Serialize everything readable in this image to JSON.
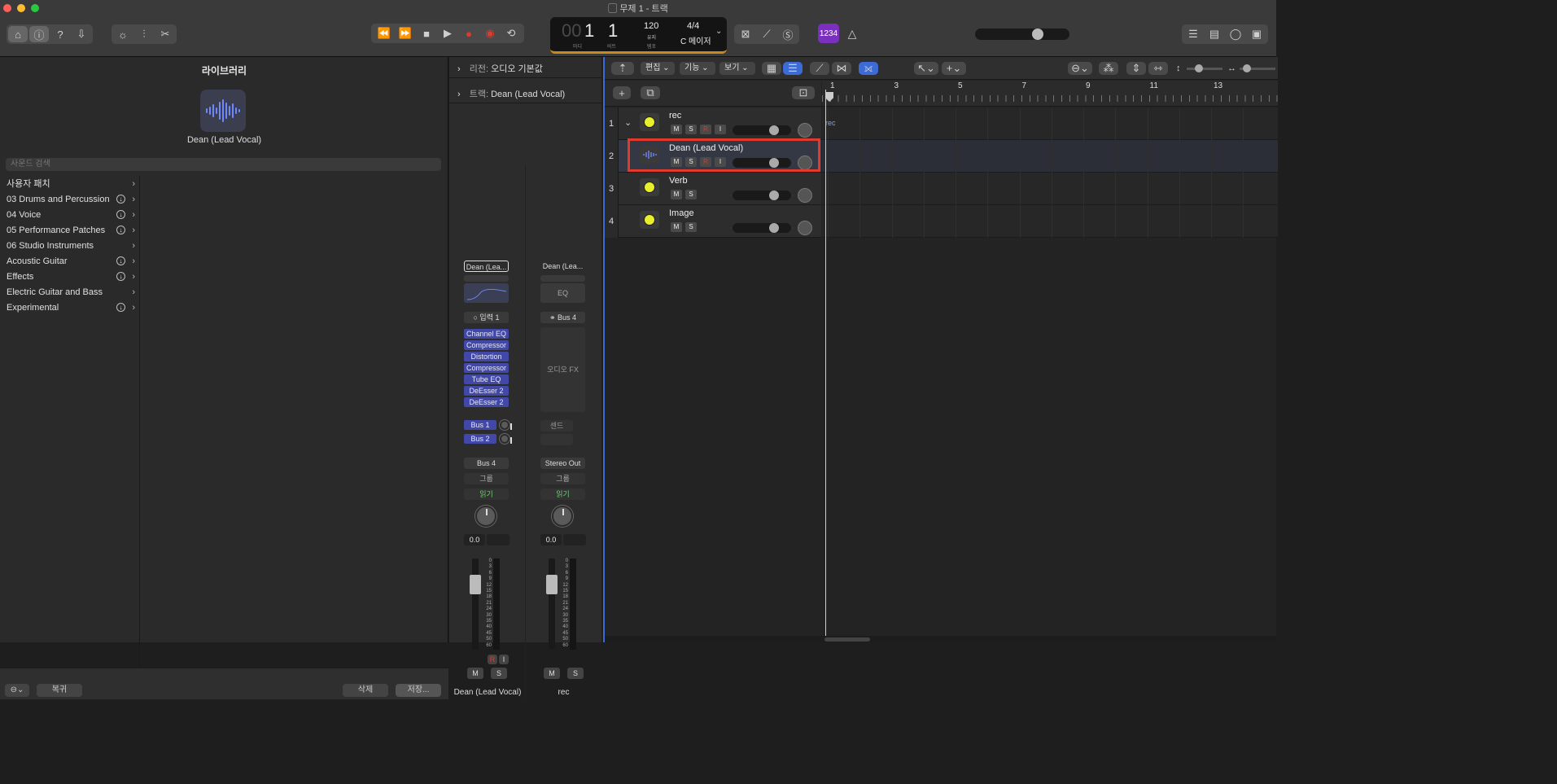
{
  "window": {
    "title": "무제 1 - 트랙"
  },
  "colors": {
    "accent": "#3d6bd6",
    "plugin": "#4148a8",
    "highlight": "#e03a2c",
    "lcd_bar": "#c98a1d"
  },
  "lcd": {
    "bar_prefix": "00",
    "bar": "1",
    "beat": "1",
    "bar_label": "마디",
    "beat_label": "비트",
    "tempo": "120",
    "tempo_mode": "유지",
    "tempo_label": "템포",
    "signature": "4/4",
    "key": "C 메이저"
  },
  "count_in": "1234",
  "library": {
    "title": "라이브러리",
    "selected_name": "Dean (Lead Vocal)",
    "search_placeholder": "사운드 검색",
    "items": [
      {
        "label": "사용자 패치",
        "download": false
      },
      {
        "label": "03 Drums and Percussion",
        "download": true
      },
      {
        "label": "04 Voice",
        "download": true
      },
      {
        "label": "05 Performance Patches",
        "download": true
      },
      {
        "label": "06 Studio Instruments",
        "download": false
      },
      {
        "label": "Acoustic Guitar",
        "download": true
      },
      {
        "label": "Effects",
        "download": true
      },
      {
        "label": "Electric Guitar and Bass",
        "download": false
      },
      {
        "label": "Experimental",
        "download": true
      }
    ],
    "revert": "복귀",
    "delete": "삭제",
    "save": "저장..."
  },
  "inspector": {
    "region_label": "리전:",
    "region_value": "오디오 기본값",
    "track_label": "트랙:",
    "track_value": "Dean (Lead Vocal)"
  },
  "strip1": {
    "setting": "Dean (Lea...",
    "input": "입력 1",
    "plugins": [
      "Channel EQ",
      "Compressor",
      "Distortion",
      "Compressor",
      "Tube EQ",
      "DeEsser 2",
      "DeEsser 2"
    ],
    "sends": [
      "Bus 1",
      "Bus 2"
    ],
    "output": "Bus 4",
    "group": "그룹",
    "automation": "읽기",
    "volume": "0.0",
    "rec": "R",
    "input_mon": "I",
    "mute": "M",
    "solo": "S",
    "name": "Dean (Lead Vocal)"
  },
  "strip2": {
    "setting": "Dean (Lea...",
    "eq": "EQ",
    "input": "Bus 4",
    "fx": "오디오 FX",
    "sends": "센드",
    "output": "Stereo Out",
    "group": "그룹",
    "automation": "읽기",
    "volume": "0.0",
    "mute": "M",
    "solo": "S",
    "name": "rec"
  },
  "meter_scale": [
    "0",
    "3",
    "6",
    "9",
    "12",
    "15",
    "18",
    "21",
    "24",
    "30",
    "35",
    "40",
    "45",
    "50",
    "60"
  ],
  "tracks_toolbar": {
    "edit": "편집",
    "functions": "기능",
    "view": "보기"
  },
  "tracks": [
    {
      "num": "1",
      "name": "rec",
      "icon": "tuner-icon",
      "buttons": [
        "M",
        "S",
        "R",
        "I"
      ]
    },
    {
      "num": "2",
      "name": "Dean (Lead Vocal)",
      "icon": "waveform-icon",
      "buttons": [
        "M",
        "S",
        "R",
        "I"
      ]
    },
    {
      "num": "3",
      "name": "Verb",
      "icon": "tuner-icon",
      "buttons": [
        "M",
        "S"
      ]
    },
    {
      "num": "4",
      "name": "Image",
      "icon": "tuner-icon",
      "buttons": [
        "M",
        "S"
      ]
    }
  ],
  "ruler": [
    "1",
    "3",
    "5",
    "7",
    "9",
    "11",
    "13"
  ],
  "region": {
    "label": "rec"
  }
}
